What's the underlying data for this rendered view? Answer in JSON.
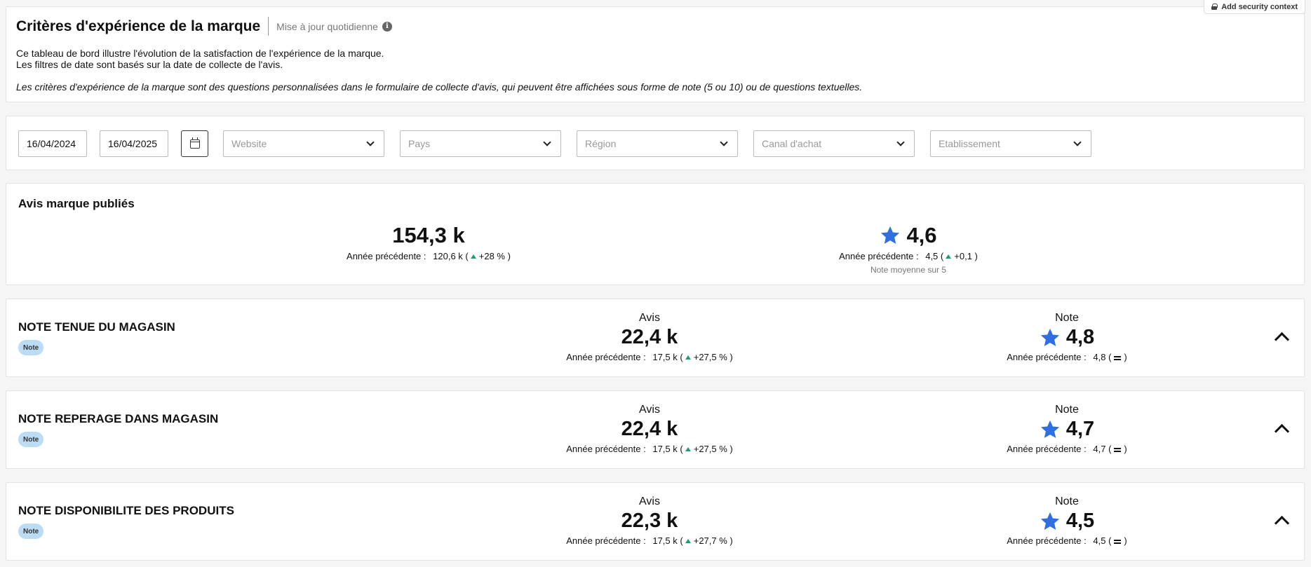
{
  "security_button": {
    "label": "Add security context",
    "icon": "lock-icon"
  },
  "header": {
    "title": "Critères d'expérience de la marque",
    "update_label": "Mise à jour quotidienne",
    "info_icon": "info-icon",
    "description_line1": "Ce tableau de bord illustre l'évolution de la satisfaction de l'expérience de la marque.",
    "description_line2": "Les filtres de date sont basés sur la date de collecte de l'avis.",
    "description_italic": "Les critères d'expérience de la marque sont des questions personnalisées dans le formulaire de collecte d'avis, qui peuvent être affichées sous forme de note (5 ou 10) ou de questions textuelles."
  },
  "filters": {
    "date_start": "16/04/2024",
    "date_end": "16/04/2025",
    "website_placeholder": "Website",
    "pays_placeholder": "Pays",
    "region_placeholder": "Région",
    "canal_placeholder": "Canal d'achat",
    "etablissement_placeholder": "Etablissement"
  },
  "summary": {
    "title": "Avis marque publiés",
    "reviews": {
      "value": "154,3 k",
      "prev_label": "Année précédente :",
      "prev_value": "120,6 k",
      "delta": "+28 %"
    },
    "rating": {
      "value": "4,6",
      "prev_label": "Année précédente :",
      "prev_value": "4,5",
      "delta": "+0,1",
      "note": "Note moyenne sur 5"
    }
  },
  "criteria": [
    {
      "title": "NOTE TENUE DU MAGASIN",
      "badge": "Note",
      "avis_label": "Avis",
      "avis_value": "22,4 k",
      "avis_prev_label": "Année précédente :",
      "avis_prev_value": "17,5 k",
      "avis_delta": "+27,5 %",
      "note_label": "Note",
      "note_value": "4,8",
      "note_prev_label": "Année précédente :",
      "note_prev_value": "4,8"
    },
    {
      "title": "NOTE REPERAGE DANS MAGASIN",
      "badge": "Note",
      "avis_label": "Avis",
      "avis_value": "22,4 k",
      "avis_prev_label": "Année précédente :",
      "avis_prev_value": "17,5 k",
      "avis_delta": "+27,5 %",
      "note_label": "Note",
      "note_value": "4,7",
      "note_prev_label": "Année précédente :",
      "note_prev_value": "4,7"
    },
    {
      "title": "NOTE DISPONIBILITE DES PRODUITS",
      "badge": "Note",
      "avis_label": "Avis",
      "avis_value": "22,3 k",
      "avis_prev_label": "Année précédente :",
      "avis_prev_value": "17,5 k",
      "avis_delta": "+27,7 %",
      "note_label": "Note",
      "note_value": "4,5",
      "note_prev_label": "Année précédente :",
      "note_prev_value": "4,5"
    }
  ],
  "colors": {
    "star": "#2f6fe0",
    "trend_up": "#1a9e6a",
    "badge_bg": "#bcdcf5"
  }
}
